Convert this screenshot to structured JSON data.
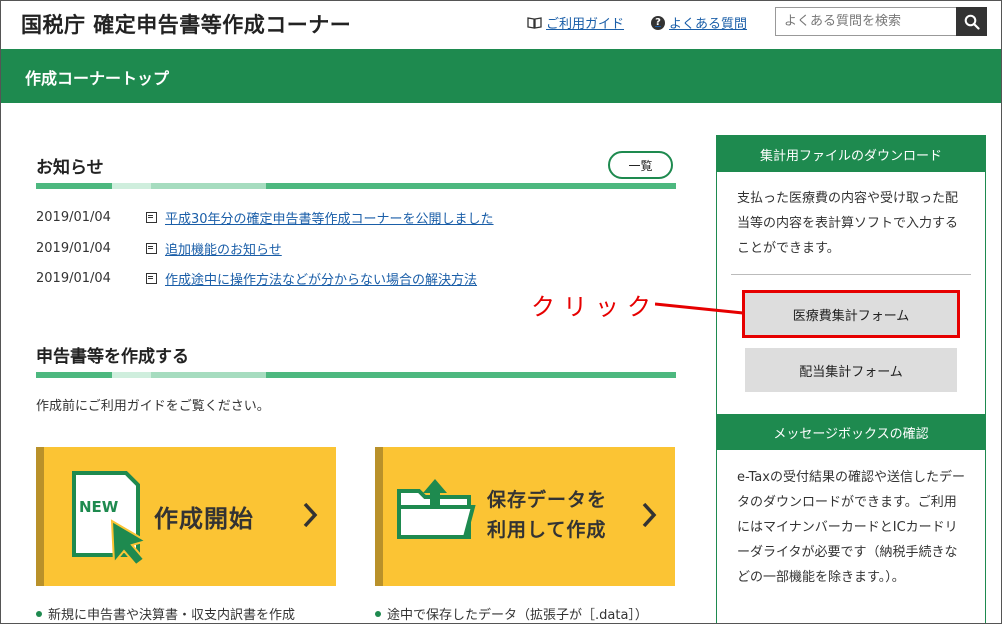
{
  "header": {
    "title": "国税庁 確定申告書等作成コーナー",
    "guide_link": "ご利用ガイド",
    "faq_link": "よくある質問",
    "search_placeholder": "よくある質問を検索"
  },
  "nav_bar": {
    "title": "作成コーナートップ"
  },
  "news": {
    "title": "お知らせ",
    "list_button": "一覧",
    "items": [
      {
        "date": "2019/01/04",
        "text": "平成30年分の確定申告書等作成コーナーを公開しました"
      },
      {
        "date": "2019/01/04",
        "text": "追加機能のお知らせ"
      },
      {
        "date": "2019/01/04",
        "text": "作成途中に操作方法などが分からない場合の解決方法"
      }
    ]
  },
  "create": {
    "title": "申告書等を作成する",
    "intro": "作成前にご利用ガイドをご覧ください。",
    "card_new": {
      "badge": "NEW",
      "label": "作成開始"
    },
    "card_saved": {
      "line1": "保存データを",
      "line2": "利用して作成"
    },
    "bullet_new": "新規に申告書や決算書・収支内訳書を作成",
    "bullet_saved": "途中で保存したデータ（拡張子が［.data］）"
  },
  "sidebar": {
    "download": {
      "title": "集計用ファイルのダウンロード",
      "text": "支払った医療費の内容や受け取った配当等の内容を表計算ソフトで入力することができます。",
      "medical_button": "医療費集計フォーム",
      "dividend_button": "配当集計フォーム"
    },
    "messagebox": {
      "title": "メッセージボックスの確認",
      "text": "e-Taxの受付結果の確認や送信したデータのダウンロードができます。ご利用にはマイナンバーカードとICカードリーダライタが必要です（納税手続きなどの一部機能を除きます。）。"
    }
  },
  "annotation": {
    "text": "クリック",
    "color": "#e60000"
  },
  "colors": {
    "brand_green": "#1e8a4f",
    "card_yellow": "#fbc434",
    "link_blue": "#1a5ea8"
  }
}
